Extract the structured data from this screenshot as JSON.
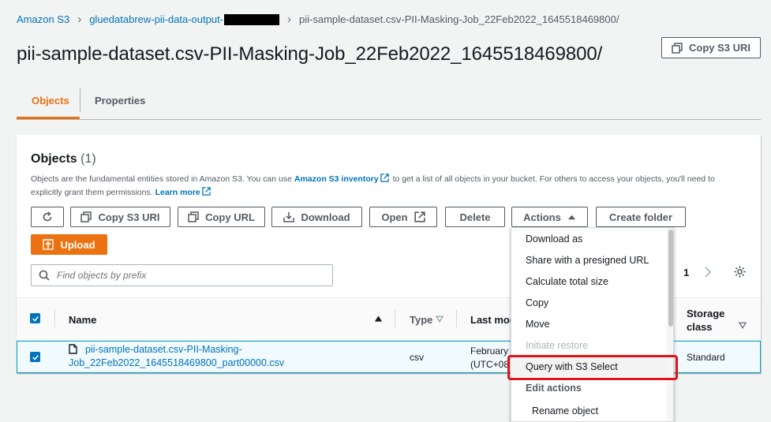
{
  "breadcrumb": {
    "root": "Amazon S3",
    "bucket": "gluedatabrew-pii-data-output-",
    "current": "pii-sample-dataset.csv-PII-Masking-Job_22Feb2022_1645518469800/"
  },
  "header": {
    "title": "pii-sample-dataset.csv-PII-Masking-Job_22Feb2022_1645518469800/",
    "copy_uri_label": "Copy S3 URI"
  },
  "tabs": [
    {
      "label": "Objects",
      "active": true
    },
    {
      "label": "Properties",
      "active": false
    }
  ],
  "objects_panel": {
    "title": "Objects",
    "count": "(1)",
    "desc_1": "Objects are the fundamental entities stored in Amazon S3. You can use ",
    "desc_link_1": "Amazon S3 inventory",
    "desc_2": " to get a list of all objects in your bucket. For others to access your objects, you'll need to explicitly grant them permissions. ",
    "desc_link_2": "Learn more",
    "toolbar": {
      "refresh_icon": "refresh-icon",
      "copy_s3_uri": "Copy S3 URI",
      "copy_url": "Copy URL",
      "download": "Download",
      "open": "Open",
      "delete": "Delete",
      "actions": "Actions",
      "create_folder": "Create folder",
      "upload": "Upload"
    },
    "search_placeholder": "Find objects by prefix",
    "page_number": "1"
  },
  "table": {
    "columns": {
      "name": "Name",
      "type": "Type",
      "last_modified": "Last mod",
      "storage_class_1": "Storage",
      "storage_class_2": "class"
    },
    "rows": [
      {
        "name_line1": "pii-sample-dataset.csv-PII-Masking-",
        "name_line2": "Job_22Feb2022_1645518469800_part00000.csv",
        "type": "csv",
        "last_modified_line1": "February",
        "last_modified_line2": "(UTC+08",
        "storage_class": "Standard",
        "selected": true
      }
    ]
  },
  "actions_menu": {
    "items": [
      {
        "label": "Download as",
        "disabled": false
      },
      {
        "label": "Share with a presigned URL",
        "disabled": false
      },
      {
        "label": "Calculate total size",
        "disabled": false
      },
      {
        "label": "Copy",
        "disabled": false
      },
      {
        "label": "Move",
        "disabled": false
      },
      {
        "label": "Initiate restore",
        "disabled": true
      },
      {
        "label": "Query with S3 Select",
        "disabled": false,
        "highlighted": true
      },
      {
        "label": "Edit actions",
        "group_header": true
      },
      {
        "label": "Rename object",
        "disabled": false
      }
    ]
  },
  "colors": {
    "link": "#0073bb",
    "accent": "#ec7211",
    "highlight_box": "#e0121a"
  }
}
